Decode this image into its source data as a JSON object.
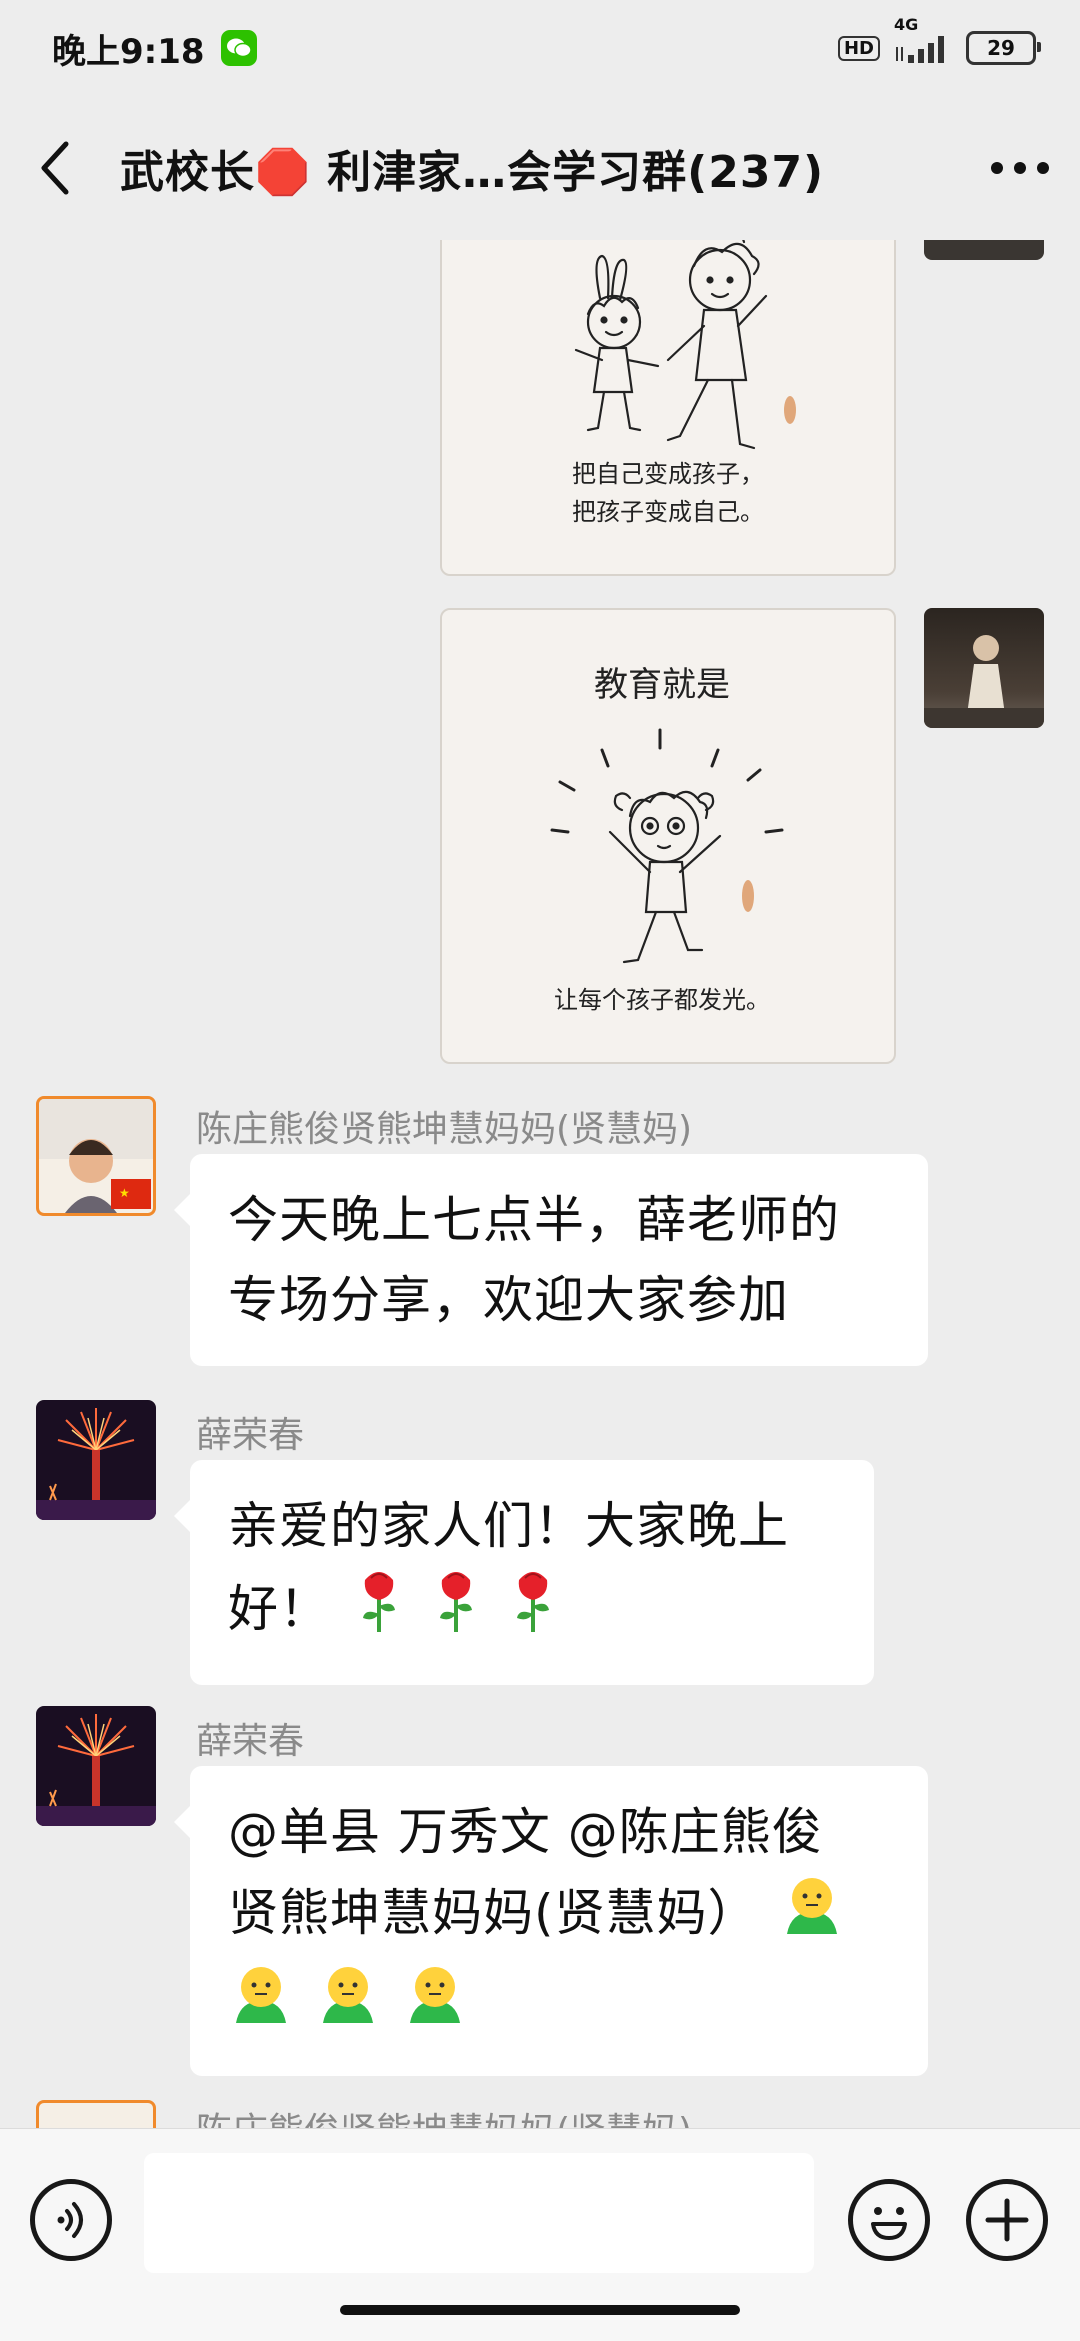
{
  "status_bar": {
    "time": "晚上9:18",
    "network": "4G",
    "hd": "HD",
    "battery": "29",
    "icons": [
      "wechat-icon",
      "hd-icon",
      "signal-icon",
      "battery-icon"
    ]
  },
  "header": {
    "title": "武校长🛑 利津家…会学习群(237)",
    "back_icon": "chevron-left-icon",
    "more_icon": "more-dots-icon"
  },
  "messages": [
    {
      "type": "image",
      "side": "right",
      "caption_lines": [
        "把自己变成孩子，",
        "把孩子变成自己。"
      ]
    },
    {
      "type": "image",
      "side": "right",
      "heading": "教育就是",
      "caption_lines": [
        "让每个孩子都发光。"
      ]
    },
    {
      "type": "text",
      "side": "left",
      "sender": "陈庄熊俊贤熊坤慧妈妈(贤慧妈)",
      "lines": [
        "今天晚上七点半，薛老师的",
        "专场分享，欢迎大家参加"
      ]
    },
    {
      "type": "text",
      "side": "left",
      "sender": "薛荣春",
      "lines": [
        "亲爱的家人们！大家晚上",
        "好！"
      ],
      "emojis": [
        "rose-emoji",
        "rose-emoji",
        "rose-emoji"
      ]
    },
    {
      "type": "text",
      "side": "left",
      "sender": "薛荣春",
      "lines": [
        "@单县  万秀文 @陈庄熊俊",
        "贤熊坤慧妈妈(贤慧妈）"
      ],
      "emojis": [
        "smiley-emoji",
        "smiley-emoji",
        "smiley-emoji",
        "smiley-emoji"
      ]
    },
    {
      "type": "text",
      "side": "left",
      "sender": "陈庄熊俊贤熊坤慧妈妈(贤慧妈)"
    }
  ],
  "input": {
    "value": "",
    "voice_icon": "voice-icon",
    "emoji_icon": "emoji-icon",
    "plus_icon": "plus-icon"
  },
  "colors": {
    "background": "#ededed",
    "bubble": "#ffffff",
    "wechat_green": "#2dc100"
  }
}
